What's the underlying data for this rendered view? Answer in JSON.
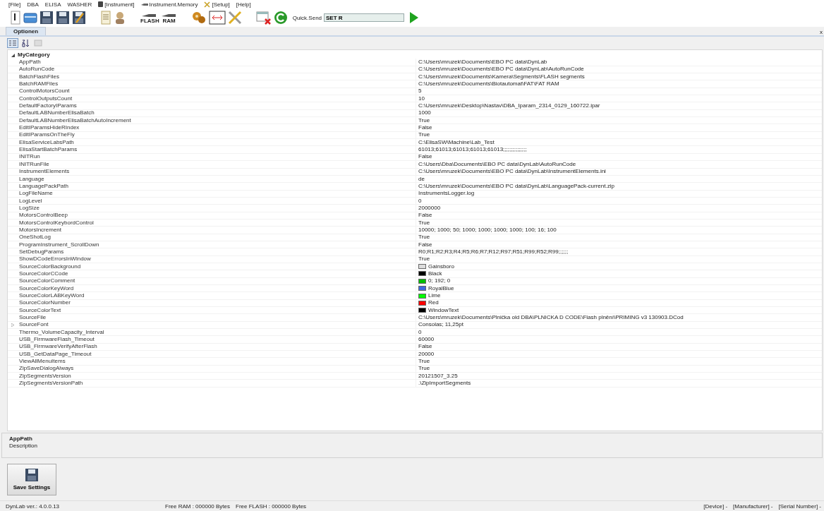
{
  "menu": [
    {
      "label": "[File]",
      "kind": "plain"
    },
    {
      "label": "DBA",
      "kind": "plain"
    },
    {
      "label": "ELISA",
      "kind": "plain"
    },
    {
      "label": "WASHER",
      "kind": "plain"
    },
    {
      "label": "[Instrument]",
      "kind": "instrument"
    },
    {
      "label": "Instrument.Memory",
      "kind": "memory"
    },
    {
      "label": "[Setup]",
      "kind": "setup"
    },
    {
      "label": "[Help]",
      "kind": "plain"
    }
  ],
  "toolbar": {
    "flash_label": "FLASH",
    "ram_label": "RAM",
    "quick_send_label": "Quick.Send",
    "quick_send_value": "SET R"
  },
  "tab": {
    "label": "Optionen",
    "selected": true,
    "close": "x"
  },
  "view_buttons": [
    {
      "kind": "categorized",
      "selected": true
    },
    {
      "kind": "alphabetical",
      "selected": false
    },
    {
      "kind": "pages",
      "disabled": true
    }
  ],
  "category": {
    "name": "MyCategory",
    "expanded": true
  },
  "properties": [
    {
      "name": "AppPath",
      "value": "C:\\Users\\mruzek\\Documents\\EBO PC  data\\DynLab",
      "kind": "text"
    },
    {
      "name": "AutoRunCode",
      "value": "C:\\Users\\mruzek\\Documents\\EBO PC  data\\DynLab\\AutoRunCode",
      "kind": "text"
    },
    {
      "name": "BatchFlashFiles",
      "value": "C:\\Users\\mruzek\\Documents\\Kamera\\Segments\\FLASH segments",
      "kind": "text"
    },
    {
      "name": "BatchRAMFiles",
      "value": "C:\\Users\\mruzek\\Documents\\Biotautomat\\FAT\\FAT RAM",
      "kind": "text"
    },
    {
      "name": "ControlMotorsCount",
      "value": "5",
      "kind": "text"
    },
    {
      "name": "ControlOutputsCount",
      "value": "10",
      "kind": "text"
    },
    {
      "name": "DefaultFactoryIParams",
      "value": "C:\\Users\\mruzek\\Desktop\\Nastav\\DBA_Iparam_2314_0129_160722.ipar",
      "kind": "text"
    },
    {
      "name": "DefaultLABNumberElisaBatch",
      "value": "1000",
      "kind": "text"
    },
    {
      "name": "DefaultLABNumberElisaBatchAutoIncrement",
      "value": "True",
      "kind": "text"
    },
    {
      "name": "EditIParamsHideRIndex",
      "value": "False",
      "kind": "text"
    },
    {
      "name": "EditIParamsOnTheFly",
      "value": "True",
      "kind": "text"
    },
    {
      "name": "ElisaServiceLabsPath",
      "value": "C:\\ElisaSW\\Machine\\Lab_Test",
      "kind": "text"
    },
    {
      "name": "ElisaStartBatchParams",
      "value": "61013;61013;61013;61013;61013;;;;;;;;;;;;;;;",
      "kind": "text"
    },
    {
      "name": "INITRun",
      "value": "False",
      "kind": "text"
    },
    {
      "name": "INITRunFile",
      "value": "C:\\Users\\Dba\\Documents\\EBO PC  data\\DynLab\\AutoRunCode",
      "kind": "text"
    },
    {
      "name": "InstrumentElements",
      "value": "C:\\Users\\mruzek\\Documents\\EBO PC  data\\DynLab\\InstrumentElements.ini",
      "kind": "text"
    },
    {
      "name": "Language",
      "value": "de",
      "kind": "text"
    },
    {
      "name": "LanguagePackPath",
      "value": "C:\\Users\\mruzek\\Documents\\EBO PC  data\\DynLab\\LanguagePack-current.zip",
      "kind": "text"
    },
    {
      "name": "LogFileName",
      "value": "InstrumentsLogger.log",
      "kind": "text"
    },
    {
      "name": "LogLevel",
      "value": "0",
      "kind": "text"
    },
    {
      "name": "LogSize",
      "value": "2000000",
      "kind": "text"
    },
    {
      "name": "MotorsControlBeep",
      "value": "False",
      "kind": "text"
    },
    {
      "name": "MotorsControlKeybordControl",
      "value": "True",
      "kind": "text"
    },
    {
      "name": "MotorsIncrement",
      "value": "10000; 1000; 50; 1000; 1000; 1000; 1000; 100; 16; 100",
      "kind": "text"
    },
    {
      "name": "OneShotLog",
      "value": "True",
      "kind": "text"
    },
    {
      "name": "ProgramInstrument_ScrollDown",
      "value": "False",
      "kind": "text"
    },
    {
      "name": "SetDebugParams",
      "value": "R0;R1;R2;R3;R4;R5;R6;R7;R12;R97;R51;R99;R52;R99;;;;;;",
      "kind": "text"
    },
    {
      "name": "ShowDCodeErrorsInWindow",
      "value": "True",
      "kind": "text"
    },
    {
      "name": "SourceColorBackground",
      "value": "Gainsboro",
      "kind": "color",
      "color": "#dcdcdc"
    },
    {
      "name": "SourceColorCCode",
      "value": "Black",
      "kind": "color",
      "color": "#000000"
    },
    {
      "name": "SourceColorComment",
      "value": "0; 192; 0",
      "kind": "color",
      "color": "#00c000"
    },
    {
      "name": "SourceColorKeyWord",
      "value": "RoyalBlue",
      "kind": "color",
      "color": "#4169e1"
    },
    {
      "name": "SourceColorLABKeyWord",
      "value": "Lime",
      "kind": "color",
      "color": "#00ff00"
    },
    {
      "name": "SourceColorNumber",
      "value": "Red",
      "kind": "color",
      "color": "#ff0000"
    },
    {
      "name": "SourceColorText",
      "value": "WindowText",
      "kind": "color",
      "color": "#000000"
    },
    {
      "name": "SourceFile",
      "value": "C:\\Users\\mruzek\\Documents\\Plnička old DBA\\PLNICKA D CODE\\Flash plnění\\PRIMING v3 130903.DCod",
      "kind": "text"
    },
    {
      "name": "SourceFont",
      "value": "Consolas; 11,25pt",
      "kind": "expandable"
    },
    {
      "name": "Thermo_VolumeCapacity_Interval",
      "value": "0",
      "kind": "text"
    },
    {
      "name": "USB_FirmwareFlash_Timeout",
      "value": "60000",
      "kind": "text"
    },
    {
      "name": "USB_FirmwareVerifyAfterFlash",
      "value": "False",
      "kind": "text"
    },
    {
      "name": "USB_GetDataPage_Timeout",
      "value": "20000",
      "kind": "text"
    },
    {
      "name": "ViewAllMenuItems",
      "value": "True",
      "kind": "text"
    },
    {
      "name": "ZipSaveDialogAlways",
      "value": "True",
      "kind": "text"
    },
    {
      "name": "ZipSegmentsVersion",
      "value": "20121507_3.25",
      "kind": "text"
    },
    {
      "name": "ZipSegmentsVersionPath",
      "value": ".\\ZipImportSegments",
      "kind": "text"
    }
  ],
  "description": {
    "title": "AppPath",
    "text": "Description"
  },
  "save_button": "Save Settings",
  "status_bar": {
    "version": "DynLab ver.: 4.0.0.13",
    "free_ram": "Free RAM : 000000 Bytes",
    "free_flash": "Free FLASH : 000000 Bytes",
    "device": "[Device] -",
    "manufacturer": "[Manufacturer] -",
    "serial": "[Serial Number] -"
  }
}
